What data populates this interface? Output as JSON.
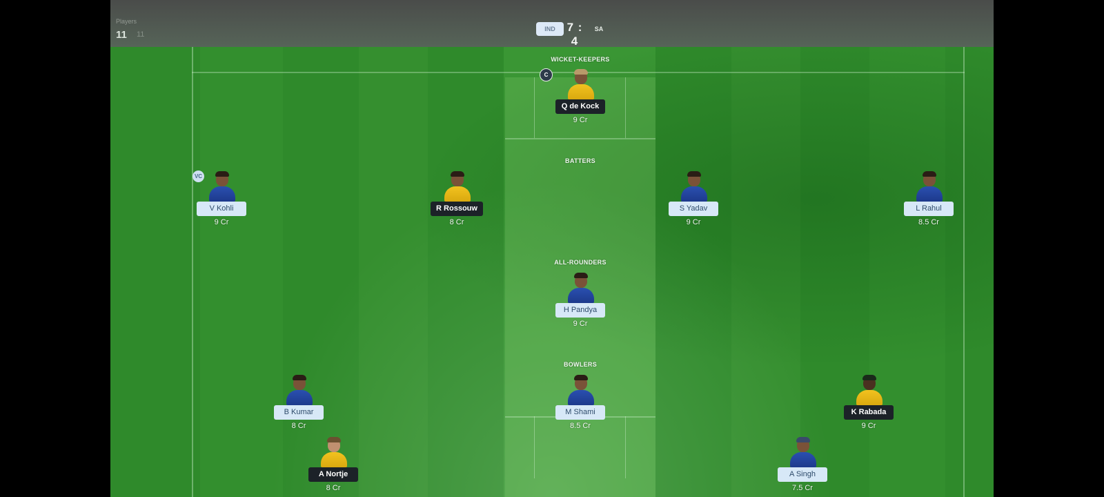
{
  "header": {
    "players_label": "Players",
    "players_count": "11",
    "players_total": "11",
    "team_left": "IND",
    "score": "7 : 4",
    "team_right": "SA"
  },
  "sections": {
    "wicket_keepers": "WICKET-KEEPERS",
    "batters": "BATTERS",
    "all_rounders": "ALL-ROUNDERS",
    "bowlers": "BOWLERS"
  },
  "badges": {
    "captain": "C",
    "vice_captain": "VC"
  },
  "players": [
    {
      "name": "Q de Kock",
      "credits": "9 Cr",
      "team": "SA"
    },
    {
      "name": "V Kohli",
      "credits": "9 Cr",
      "team": "IND"
    },
    {
      "name": "R Rossouw",
      "credits": "8 Cr",
      "team": "SA"
    },
    {
      "name": "S Yadav",
      "credits": "9 Cr",
      "team": "IND"
    },
    {
      "name": "L Rahul",
      "credits": "8.5 Cr",
      "team": "IND"
    },
    {
      "name": "H Pandya",
      "credits": "9 Cr",
      "team": "IND"
    },
    {
      "name": "B Kumar",
      "credits": "8 Cr",
      "team": "IND"
    },
    {
      "name": "M Shami",
      "credits": "8.5 Cr",
      "team": "IND"
    },
    {
      "name": "K Rabada",
      "credits": "9 Cr",
      "team": "SA"
    },
    {
      "name": "A Nortje",
      "credits": "8 Cr",
      "team": "SA"
    },
    {
      "name": "A Singh",
      "credits": "7.5 Cr",
      "team": "IND"
    }
  ],
  "colors": {
    "ind_jersey": "#2a4fb0",
    "sa_jersey": "#f2c21f",
    "ind_tag": "#d7e8f7",
    "sa_tag": "#1c2228",
    "field": "#2f8a2b"
  }
}
